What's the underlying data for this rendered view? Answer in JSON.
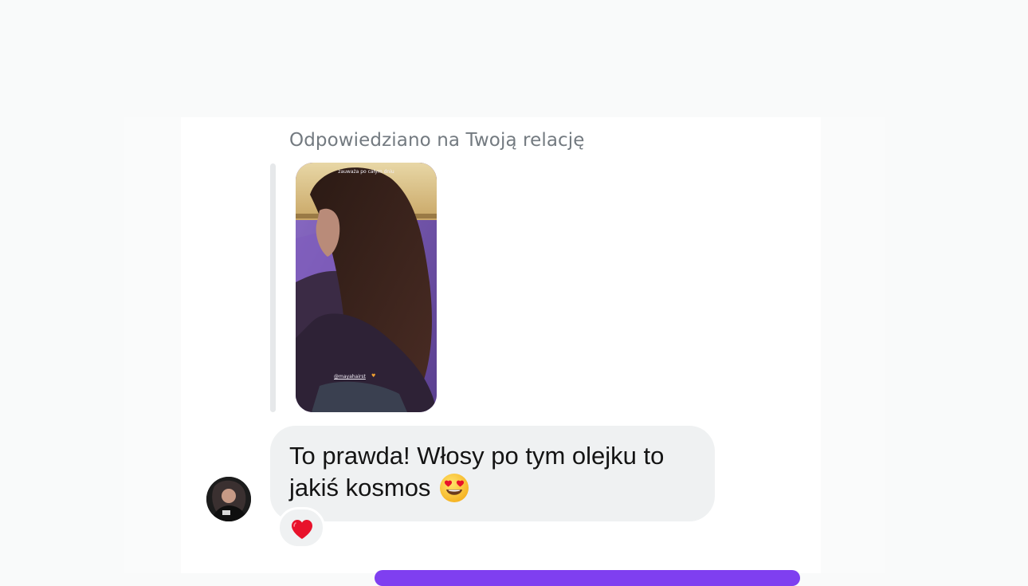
{
  "chat": {
    "reply_context": "Odpowiedziano na Twoją relację",
    "story": {
      "caption": "zauważa po całym dniu",
      "mention": "@mayahairst",
      "mention_emoji": "heart-emoji"
    },
    "message": {
      "text": "To prawda! Włosy po tym olejku to jakiś kosmos",
      "emoji": "smiling-face-with-heart-eyes-icon"
    },
    "reaction": {
      "emoji": "red-heart-icon"
    },
    "avatar": "avatar"
  },
  "colors": {
    "bubble": "#eff1f2",
    "accent": "#7f3ff0",
    "label": "#737a80",
    "heart": "#e8122b"
  }
}
